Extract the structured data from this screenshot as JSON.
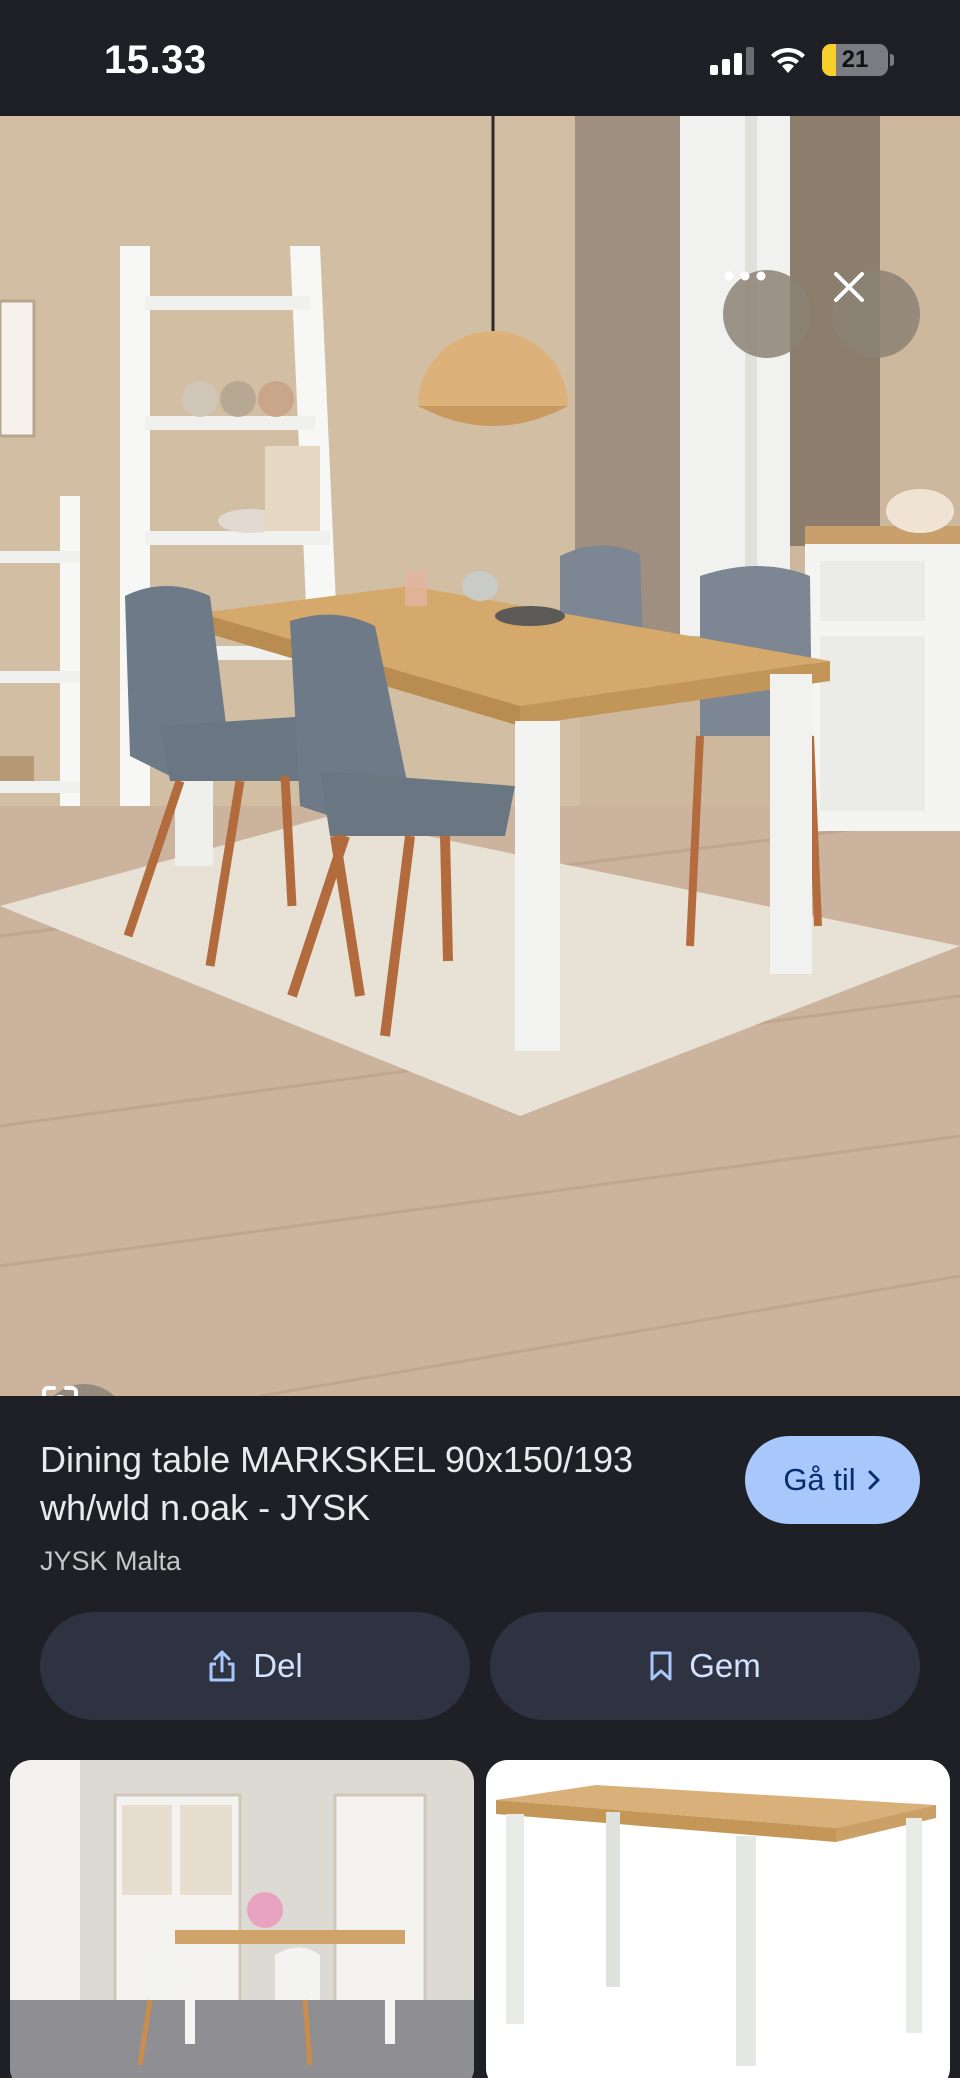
{
  "status_bar": {
    "time": "15.33",
    "battery": "21",
    "battery_level_percent": 21
  },
  "viewer": {
    "more_icon": "more-horizontal-icon",
    "close_icon": "close-icon",
    "lens_icon": "google-lens-icon"
  },
  "result": {
    "title": "Dining table MARKSKEL 90x150/193 wh/wld n.oak - JYSK",
    "source": "JYSK Malta",
    "goto_label": "Gå til",
    "share_label": "Del",
    "save_label": "Gem"
  },
  "colors": {
    "background": "#1f2025",
    "goto_button": "#a8c7fa",
    "action_button": "#2e3241",
    "action_text": "#d3e3fd"
  }
}
